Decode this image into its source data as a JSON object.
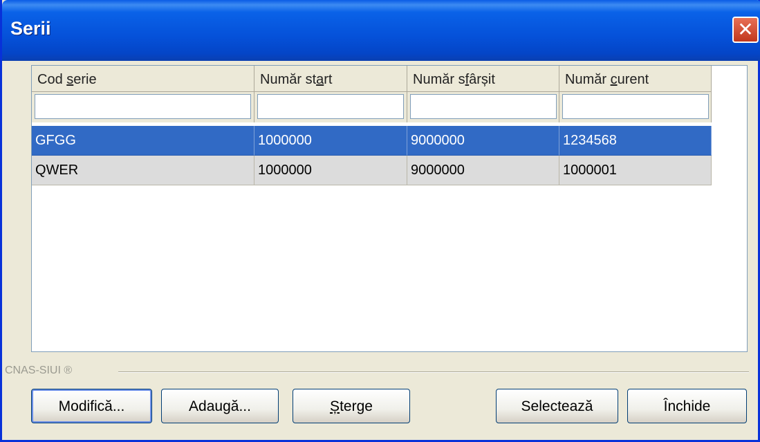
{
  "window": {
    "title": "Serii",
    "close_icon": "close-icon"
  },
  "grid": {
    "columns": [
      {
        "pre": "Cod ",
        "accel": "s",
        "post": "erie"
      },
      {
        "pre": "Număr st",
        "accel": "a",
        "post": "rt"
      },
      {
        "pre": "Număr s",
        "accel": "f",
        "post": "ârșit"
      },
      {
        "pre": "Număr ",
        "accel": "c",
        "post": "urent"
      }
    ],
    "filters": [
      "",
      "",
      "",
      ""
    ],
    "rows": [
      {
        "selected": true,
        "cells": [
          "GFGG",
          "1000000",
          "9000000",
          "1234568"
        ]
      },
      {
        "selected": false,
        "cells": [
          "QWER",
          "1000000",
          "9000000",
          "1000001"
        ]
      }
    ]
  },
  "footer": {
    "label": "CNAS-SIUI ®"
  },
  "buttons": {
    "modify": "Modifică...",
    "add": "Adaugă...",
    "delete": {
      "accel": "Ș",
      "rest": "terge"
    },
    "select": "Selectează",
    "close": "Închide"
  },
  "colors": {
    "selection": "#316ac5",
    "titlebar": "#0551d9",
    "close": "#c1371d"
  }
}
